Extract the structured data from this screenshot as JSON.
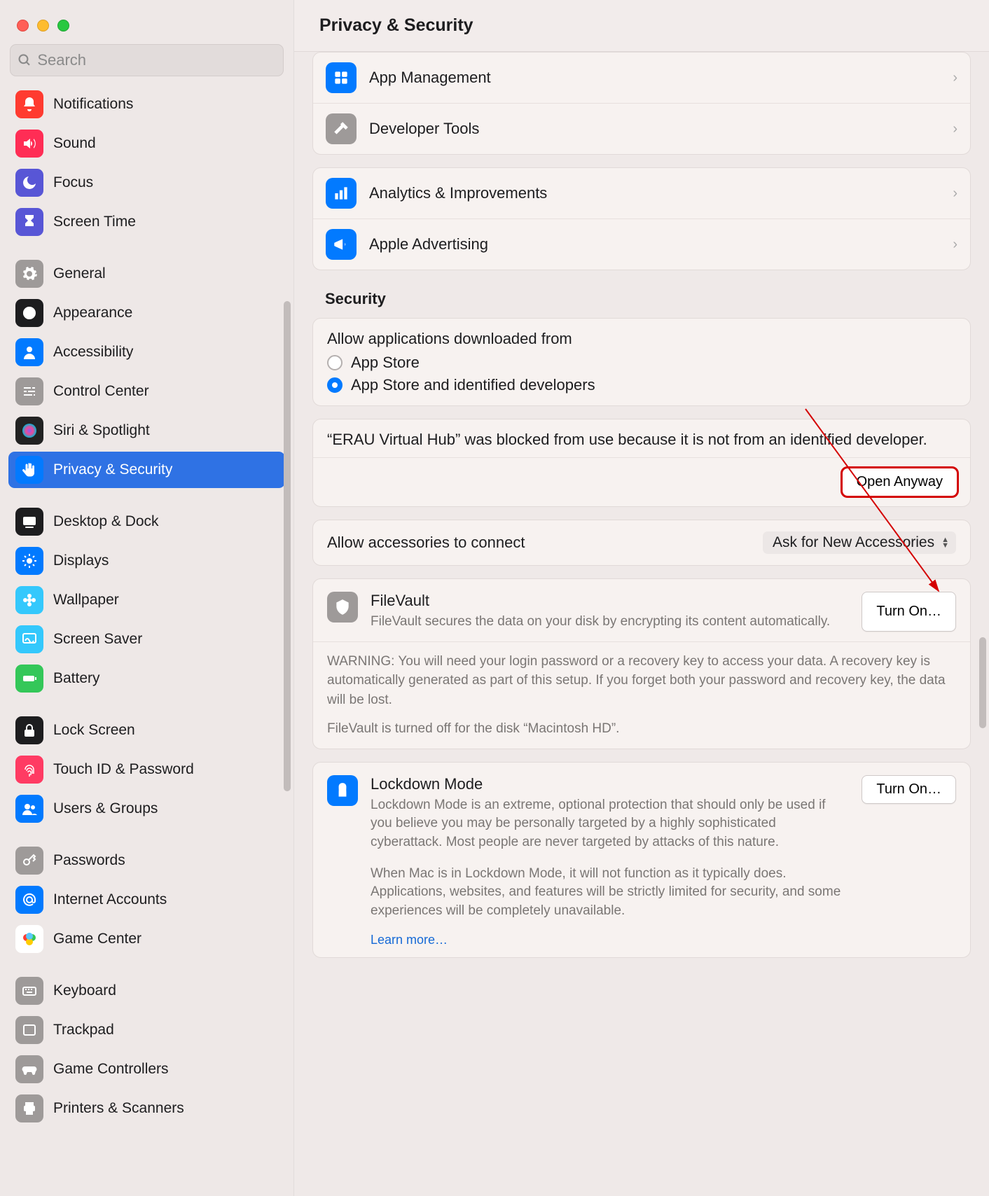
{
  "header": {
    "title": "Privacy & Security"
  },
  "search": {
    "placeholder": "Search"
  },
  "sidebar": {
    "groups": [
      [
        {
          "id": "notifications",
          "label": "Notifications",
          "bg": "#ff3b30",
          "icon": "bell"
        },
        {
          "id": "sound",
          "label": "Sound",
          "bg": "#ff2d55",
          "icon": "speaker"
        },
        {
          "id": "focus",
          "label": "Focus",
          "bg": "#5856d6",
          "icon": "moon"
        },
        {
          "id": "screen-time",
          "label": "Screen Time",
          "bg": "#5856d6",
          "icon": "hourglass"
        }
      ],
      [
        {
          "id": "general",
          "label": "General",
          "bg": "#9e9a99",
          "icon": "gear"
        },
        {
          "id": "appearance",
          "label": "Appearance",
          "bg": "#1d1d1f",
          "icon": "appearance"
        },
        {
          "id": "accessibility",
          "label": "Accessibility",
          "bg": "#027aff",
          "icon": "person"
        },
        {
          "id": "control-center",
          "label": "Control Center",
          "bg": "#9e9a99",
          "icon": "sliders"
        },
        {
          "id": "siri",
          "label": "Siri & Spotlight",
          "bg": "#222",
          "icon": "siri"
        },
        {
          "id": "privacy",
          "label": "Privacy & Security",
          "bg": "#027aff",
          "icon": "hand",
          "selected": true
        }
      ],
      [
        {
          "id": "desktop-dock",
          "label": "Desktop & Dock",
          "bg": "#1d1d1f",
          "icon": "dock"
        },
        {
          "id": "displays",
          "label": "Displays",
          "bg": "#027aff",
          "icon": "sun"
        },
        {
          "id": "wallpaper",
          "label": "Wallpaper",
          "bg": "#34c8fc",
          "icon": "flower"
        },
        {
          "id": "screen-saver",
          "label": "Screen Saver",
          "bg": "#34c8fc",
          "icon": "screensaver"
        },
        {
          "id": "battery",
          "label": "Battery",
          "bg": "#34c759",
          "icon": "battery"
        }
      ],
      [
        {
          "id": "lock-screen",
          "label": "Lock Screen",
          "bg": "#1d1d1f",
          "icon": "lock"
        },
        {
          "id": "touch-id",
          "label": "Touch ID & Password",
          "bg": "#ff3b63",
          "icon": "fingerprint"
        },
        {
          "id": "users-groups",
          "label": "Users & Groups",
          "bg": "#027aff",
          "icon": "users"
        }
      ],
      [
        {
          "id": "passwords",
          "label": "Passwords",
          "bg": "#9e9a99",
          "icon": "key"
        },
        {
          "id": "internet-accounts",
          "label": "Internet Accounts",
          "bg": "#027aff",
          "icon": "at"
        },
        {
          "id": "game-center",
          "label": "Game Center",
          "bg": "#fff",
          "icon": "gamecenter"
        }
      ],
      [
        {
          "id": "keyboard",
          "label": "Keyboard",
          "bg": "#9e9a99",
          "icon": "keyboard"
        },
        {
          "id": "trackpad",
          "label": "Trackpad",
          "bg": "#9e9a99",
          "icon": "trackpad"
        },
        {
          "id": "game-controllers",
          "label": "Game Controllers",
          "bg": "#9e9a99",
          "icon": "controller"
        },
        {
          "id": "printers-scanners",
          "label": "Printers & Scanners",
          "bg": "#9e9a99",
          "icon": "printer"
        }
      ]
    ]
  },
  "main": {
    "top_rows": [
      {
        "label": "App Management",
        "bg": "#027aff",
        "icon": "apps"
      },
      {
        "label": "Developer Tools",
        "bg": "#9e9a99",
        "icon": "hammer"
      }
    ],
    "analytics_rows": [
      {
        "label": "Analytics & Improvements",
        "bg": "#027aff",
        "icon": "chart"
      },
      {
        "label": "Apple Advertising",
        "bg": "#027aff",
        "icon": "megaphone"
      }
    ],
    "section_title": "Security",
    "allow_apps": {
      "title": "Allow applications downloaded from",
      "options": [
        {
          "label": "App Store",
          "checked": false
        },
        {
          "label": "App Store and identified developers",
          "checked": true
        }
      ]
    },
    "blocked_message": "“ERAU Virtual Hub” was blocked from use because it is not from an identified developer.",
    "open_anyway_label": "Open Anyway",
    "accessories": {
      "label": "Allow accessories to connect",
      "value": "Ask for New Accessories"
    },
    "filevault": {
      "title": "FileVault",
      "desc": "FileVault secures the data on your disk by encrypting its content automatically.",
      "warn": "WARNING: You will need your login password or a recovery key to access your data. A recovery key is automatically generated as part of this setup. If you forget both your password and recovery key, the data will be lost.",
      "status": "FileVault is turned off for the disk “Macintosh HD”.",
      "button": "Turn On…"
    },
    "lockdown": {
      "title": "Lockdown Mode",
      "desc1": "Lockdown Mode is an extreme, optional protection that should only be used if you believe you may be personally targeted by a highly sophisticated cyberattack. Most people are never targeted by attacks of this nature.",
      "desc2": "When Mac is in Lockdown Mode, it will not function as it typically does. Applications, websites, and features will be strictly limited for security, and some experiences will be completely unavailable.",
      "learn": "Learn more…",
      "button": "Turn On…"
    }
  }
}
